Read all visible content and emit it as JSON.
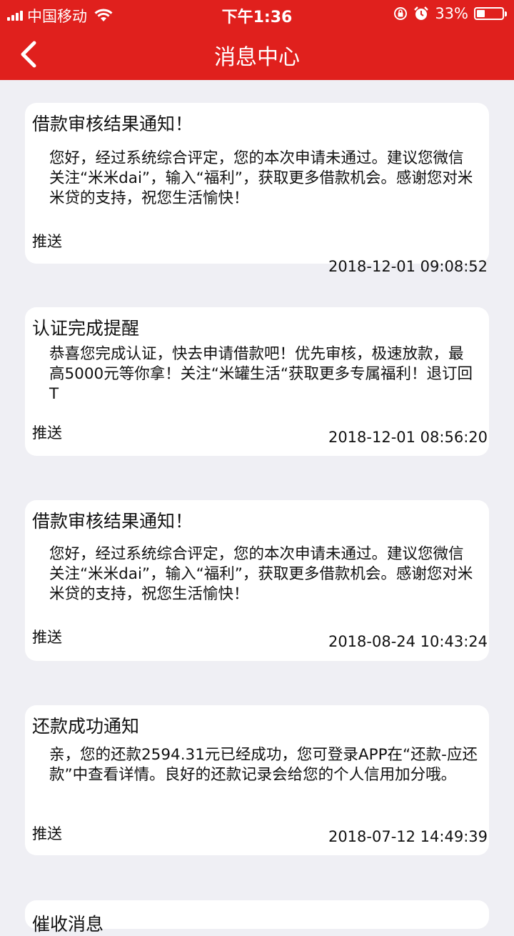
{
  "status_bar": {
    "carrier": "中国移动",
    "time": "下午1:36",
    "battery_percent": "33%",
    "battery_level": 0.33,
    "icons": [
      "signal-icon",
      "wifi-icon",
      "orientation-lock-icon",
      "alarm-icon",
      "battery-icon"
    ]
  },
  "nav": {
    "title": "消息中心",
    "back_icon": "chevron-left-icon"
  },
  "colors": {
    "accent": "#e0201d",
    "background": "#efeff4",
    "card": "#ffffff"
  },
  "messages": [
    {
      "title": "借款审核结果通知！",
      "body": "您好，经过系统综合评定，您的本次申请未通过。建议您微信关注“米米dai”，输入“福利”，获取更多借款机会。感谢您对米米贷的支持，祝您生活愉快！",
      "tag": "推送",
      "time": "2018-12-01 09:08:52"
    },
    {
      "title": "认证完成提醒",
      "body": "恭喜您完成认证，快去申请借款吧！优先审核，极速放款，最高5000元等你拿！关注“米罐生活“获取更多专属福利！退订回T",
      "tag": "推送",
      "time": "2018-12-01 08:56:20"
    },
    {
      "title": "借款审核结果通知！",
      "body": "您好，经过系统综合评定，您的本次申请未通过。建议您微信关注“米米dai”，输入“福利”，获取更多借款机会。感谢您对米米贷的支持，祝您生活愉快！",
      "tag": "推送",
      "time": "2018-08-24 10:43:24"
    },
    {
      "title": "还款成功通知",
      "body": "亲，您的还款2594.31元已经成功，您可登录APP在“还款-应还款”中查看详情。良好的还款记录会给您的个人信用加分哦。",
      "tag": "推送",
      "time": "2018-07-12 14:49:39"
    },
    {
      "title": "催收消息"
    }
  ]
}
